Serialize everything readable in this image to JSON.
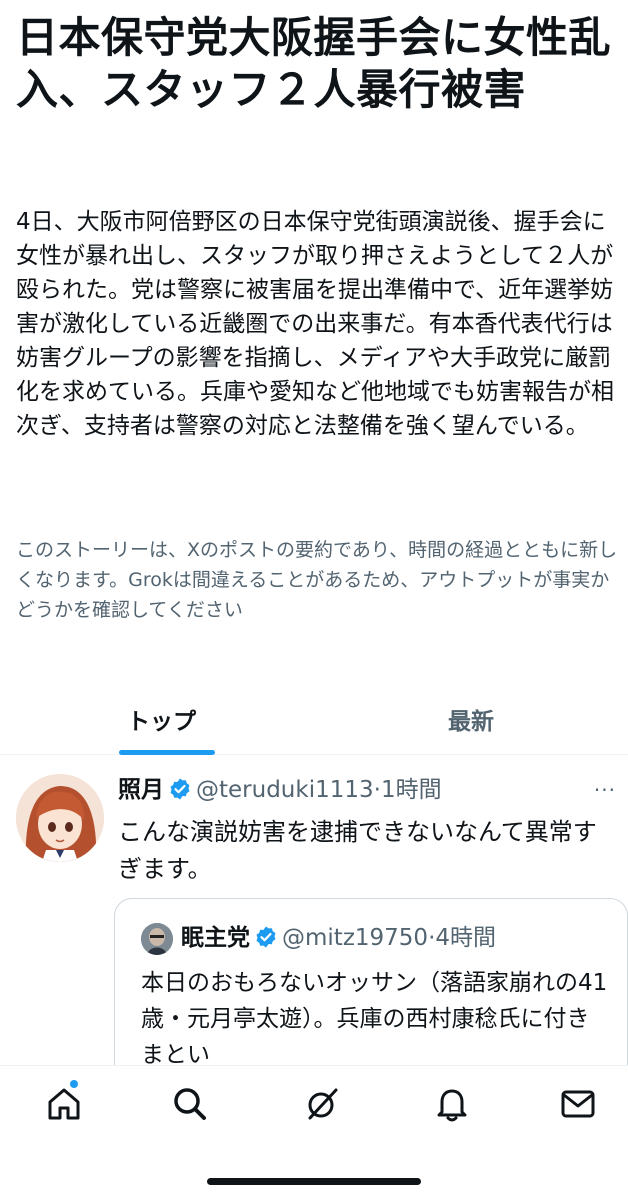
{
  "story": {
    "headline": "日本保守党大阪握手会に女性乱入、スタッフ２人暴行被害",
    "summary": "4日、大阪市阿倍野区の日本保守党街頭演説後、握手会に女性が暴れ出し、スタッフが取り押さえようとして２人が殴られた。党は警察に被害届を提出準備中で、近年選挙妨害が激化している近畿圏での出来事だ。有本香代表代行は妨害グループの影響を指摘し、メディアや大手政党に厳罰化を求めている。兵庫や愛知など他地域でも妨害報告が相次ぎ、支持者は警察の対応と法整備を強く望んでいる。",
    "disclaimer": "このストーリーは、Xのポストの要約であり、時間の経過とともに新しくなります。Grokは間違えることがあるため、アウトプットが事実かどうかを確認してください"
  },
  "tabs": [
    {
      "label": "トップ",
      "active": true
    },
    {
      "label": "最新",
      "active": false
    }
  ],
  "post": {
    "name": "照月",
    "handle": "@teruduki1113",
    "separator": "·",
    "time": "1時間",
    "more": "···",
    "text": "こんな演説妨害を逮捕できないなんて異常すぎます。",
    "quote": {
      "name": "眠主党",
      "handle": "@mitz19750",
      "separator": "·",
      "time": "4時間",
      "text": "本日のおもろないオッサン（落語家崩れの41歳・元月亭太遊）。兵庫の西村康稔氏に付きまとい"
    }
  },
  "nav": {
    "items": [
      "home-icon",
      "search-icon",
      "grok-icon",
      "notifications-icon",
      "messages-icon"
    ],
    "home_has_badge": true
  },
  "colors": {
    "accent": "#1d9bf0",
    "text": "#0f1419",
    "secondary": "#536471",
    "border": "#cfd9de"
  }
}
